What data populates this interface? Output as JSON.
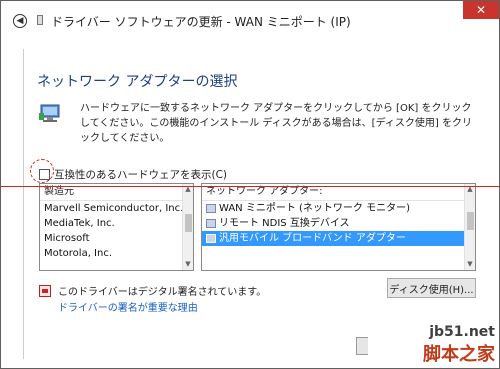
{
  "window": {
    "title": "ドライバー ソフトウェアの更新 - WAN ミニポート (IP)",
    "back_icon": "back-arrow-icon",
    "close_icon": "close-icon",
    "close_label": "✕"
  },
  "main": {
    "heading": "ネットワーク アダプターの選択",
    "description": "ハードウェアに一致するネットワーク アダプターをクリックしてから [OK] をクリックしてください。この機能のインストール ディスクがある場合は、[ディスク使用] をクリックしてください。",
    "compat_label": "互換性のあるハードウェアを表示(C)"
  },
  "manufacturer_list": {
    "header": "製造元",
    "items": [
      {
        "label": "Marvell Semiconductor, Inc."
      },
      {
        "label": "MediaTek, Inc."
      },
      {
        "label": "Microsoft"
      },
      {
        "label": "Motorola, Inc."
      }
    ]
  },
  "model_list": {
    "header": "ネットワーク アダプター:",
    "items": [
      {
        "label": "WAN ミニポート (ネットワーク モニター)"
      },
      {
        "label": "リモート NDIS 互換デバイス"
      },
      {
        "label": "汎用モバイル ブロードバンド アダプター"
      }
    ],
    "selected_index": 2
  },
  "footer": {
    "signed_text": "このドライバーはデジタル署名されています。",
    "why_link": "ドライバーの署名が重要な理由",
    "disk_button": "ディスク使用(H)..."
  },
  "watermark": {
    "url": "jb51.net",
    "cn": "脚本之家"
  },
  "colors": {
    "heading": "#1d3d8e",
    "selection": "#3399ff",
    "link": "#1a5fc7",
    "annotation_red": "#d6221b"
  }
}
